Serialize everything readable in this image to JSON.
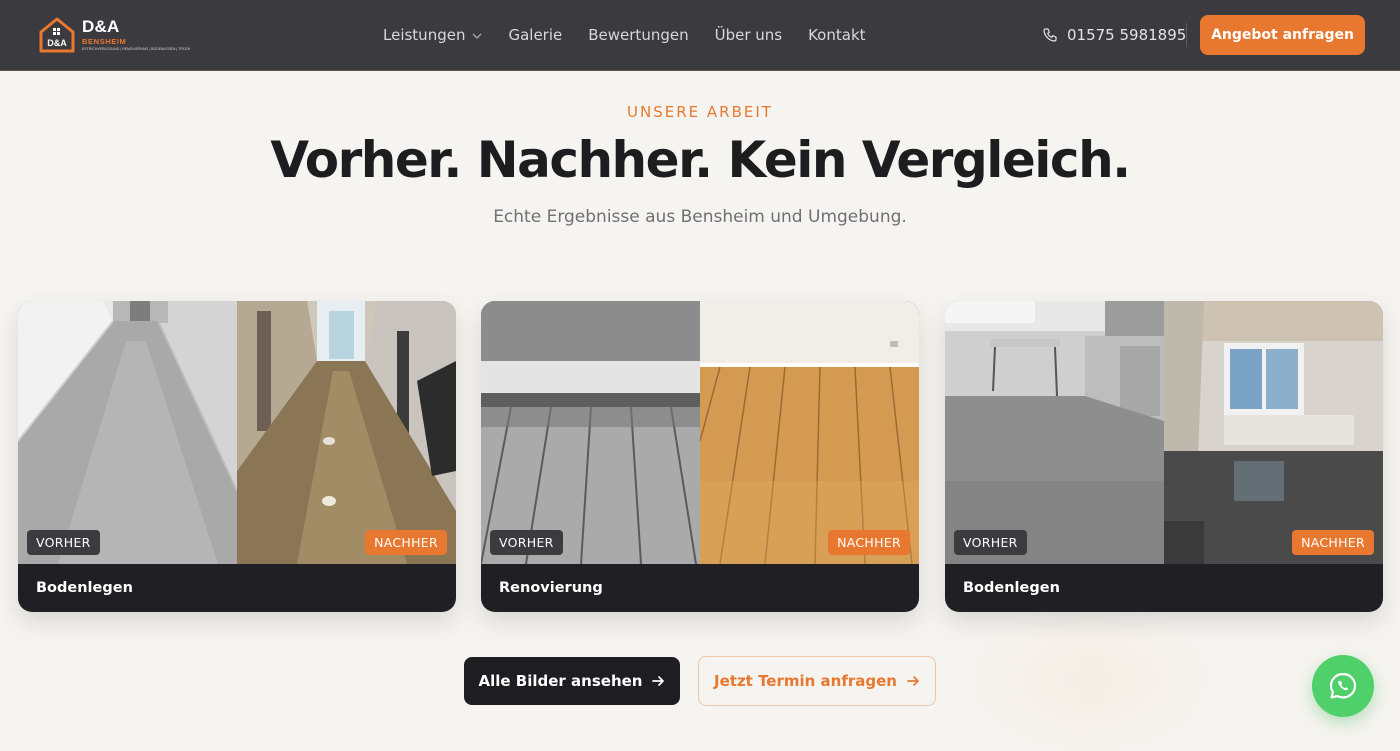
{
  "brand": {
    "title": "D&A",
    "subtitle": "BENSHEIM",
    "tagline": "ESTRICHVERLEGUNG | RENOVIERUNG | BODENLEGEN | TROCKENBAU",
    "house_initials": "D&A"
  },
  "nav": {
    "items": [
      {
        "label": "Leistungen",
        "has_dropdown": true
      },
      {
        "label": "Galerie"
      },
      {
        "label": "Bewertungen"
      },
      {
        "label": "Über uns"
      },
      {
        "label": "Kontakt"
      }
    ],
    "phone": "01575 5981895",
    "cta_label": "Angebot anfragen"
  },
  "hero": {
    "eyebrow": "UNSERE ARBEIT",
    "headline": "Vorher. Nachher. Kein Vergleich.",
    "subline": "Echte Ergebnisse aus Bensheim und Umgebung."
  },
  "cards": [
    {
      "caption": "Bodenlegen",
      "before_label": "VORHER",
      "after_label": "NACHHER"
    },
    {
      "caption": "Renovierung",
      "before_label": "VORHER",
      "after_label": "NACHHER"
    },
    {
      "caption": "Bodenlegen",
      "before_label": "VORHER",
      "after_label": "NACHHER"
    }
  ],
  "actions": {
    "primary_label": "Alle Bilder ansehen",
    "secondary_label": "Jetzt Termin anfragen"
  },
  "colors": {
    "accent": "#e8782f",
    "header_bg": "#3a3a3f",
    "page_bg": "#f6f4f0",
    "dark": "#1d1d22",
    "whatsapp": "#4fd06a"
  },
  "icons": {
    "phone": "phone-icon",
    "chevron": "chevron-down-icon",
    "arrow": "arrow-right-icon",
    "whatsapp": "whatsapp-icon",
    "logo": "house-logo-icon"
  }
}
